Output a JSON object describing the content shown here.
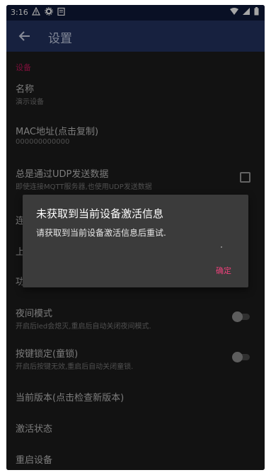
{
  "status_bar": {
    "time": "3:16"
  },
  "app_bar": {
    "title": "设置"
  },
  "section": {
    "header": "设备"
  },
  "prefs": [
    {
      "title": "名称",
      "summary": "演示设备"
    },
    {
      "title": "MAC地址(点击复制)",
      "summary": "000000000000"
    },
    {
      "title": "总是通过UDP发送数据",
      "summary": "即使连接MQTT服务器,也使用UDP发送数据",
      "widget": "checkbox",
      "checked": false
    },
    {
      "title": "连",
      "summary": ""
    },
    {
      "title": "上",
      "summary": ""
    },
    {
      "title": "功",
      "summary": ""
    },
    {
      "title": "夜间模式",
      "summary": "开启后led会熄灭,重启后自动关闭夜间模式.",
      "widget": "switch",
      "on": false
    },
    {
      "title": "按键锁定(童锁)",
      "summary": "开启后按键无效,重启后自动关闭童锁.",
      "widget": "switch",
      "on": false
    },
    {
      "title": "当前版本(点击检查新版本)",
      "summary": ""
    },
    {
      "title": "激活状态",
      "summary": ""
    },
    {
      "title": "重启设备",
      "summary": ""
    }
  ],
  "dialog": {
    "title": "未获取到当前设备激活信息",
    "message": "请获取到当前设备激活信息后重试.",
    "ok_label": "确定"
  },
  "colors": {
    "app_bar": "#243462",
    "status_bar": "#0f1a3a",
    "accent": "#ec407a",
    "background": "#1c1c1c"
  }
}
